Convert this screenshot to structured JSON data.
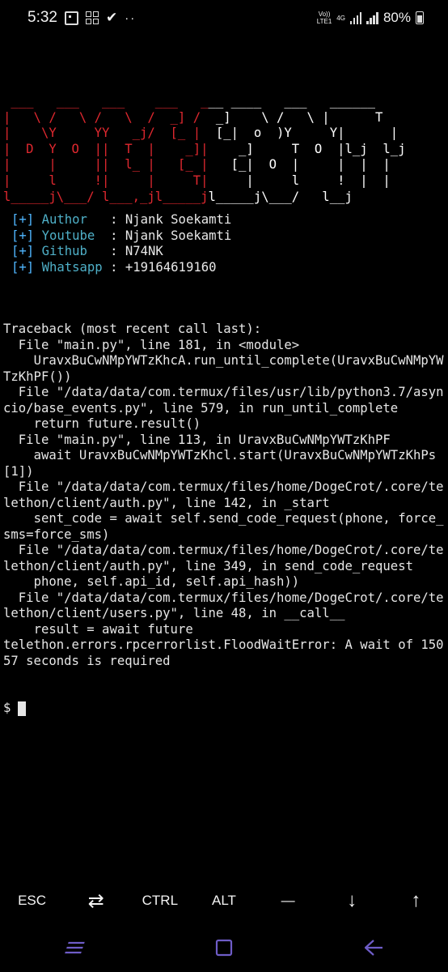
{
  "status_bar": {
    "time": "5:32",
    "network_top": "Vo))",
    "network_bottom": "LTE1",
    "network_type": "4G",
    "battery": "80%",
    "icons": [
      "screenshot-icon",
      "apps-icon",
      "check-icon",
      "more-dots-icon",
      "signal-icon",
      "battery-icon"
    ]
  },
  "banner": {
    "lines": [
      " ___   ___   ___    ___   ___ ____   ___   ______",
      "|   \\ /   \\ /   \\  /  _] /  _]    \\ /   \\ |      T",
      "|    \\Y     YY   _j/  [_ |  [_|  o  )Y     Y|      |",
      "|  D  Y  O  ||  T  |    _]|    _]     T  O  |l_j  l_j",
      "|     |     ||  l_ |   [_ |   [_|  O  |     |  |  |",
      "|     l     !|     |     T|     |     l     !  |  |",
      "l_____j\\___/ l___,_jl_____jl_____j\\___/   l__j"
    ],
    "colors": {
      "doge": "#e0282f",
      "crot": "#ffffff"
    }
  },
  "info": [
    {
      "tag": "[+]",
      "key": "Author   ",
      "value": ": Njank Soekamti"
    },
    {
      "tag": "[+]",
      "key": "Youtube  ",
      "value": ": Njank Soekamti"
    },
    {
      "tag": "[+]",
      "key": "Github   ",
      "value": ": N74NK"
    },
    {
      "tag": "[+]",
      "key": "Whatsapp ",
      "value": ": +19164619160"
    }
  ],
  "traceback": "Traceback (most recent call last):\n  File \"main.py\", line 181, in <module>\n    UravxBuCwNMpYWTzKhcA.run_until_complete(UravxBuCwNMpYWTzKhPF())\n  File \"/data/data/com.termux/files/usr/lib/python3.7/asyncio/base_events.py\", line 579, in run_until_complete\n    return future.result()\n  File \"main.py\", line 113, in UravxBuCwNMpYWTzKhPF\n    await UravxBuCwNMpYWTzKhcl.start(UravxBuCwNMpYWTzKhPs[1])\n  File \"/data/data/com.termux/files/home/DogeCrot/.core/telethon/client/auth.py\", line 142, in _start\n    sent_code = await self.send_code_request(phone, force_sms=force_sms)\n  File \"/data/data/com.termux/files/home/DogeCrot/.core/telethon/client/auth.py\", line 349, in send_code_request\n    phone, self.api_id, self.api_hash))\n  File \"/data/data/com.termux/files/home/DogeCrot/.core/telethon/client/users.py\", line 48, in __call__\n    result = await future\ntelethon.errors.rpcerrorlist.FloodWaitError: A wait of 15057 seconds is required",
  "prompt": "$",
  "extra_keys": {
    "esc": "ESC",
    "tab": "⇄",
    "ctrl": "CTRL",
    "alt": "ALT",
    "dash": "—",
    "down": "↓",
    "up": "↑"
  },
  "navbar": [
    "recents-icon",
    "home-icon",
    "back-icon"
  ]
}
